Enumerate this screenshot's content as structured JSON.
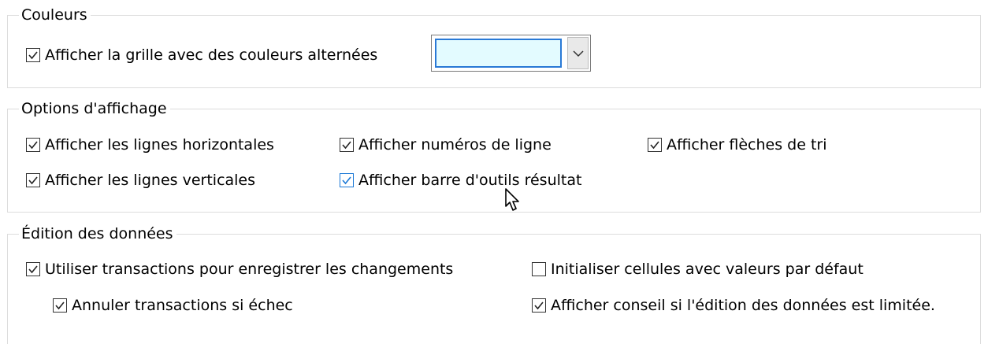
{
  "colors": {
    "legend": "Couleurs",
    "alt_grid": {
      "label": "Afficher la grille avec des couleurs alternées",
      "checked": true
    },
    "color_dropdown": {
      "value": "",
      "swatch_color": "#e3fbff",
      "icon": "chevron-down-icon"
    }
  },
  "display": {
    "legend": "Options d'affichage",
    "items": [
      {
        "label": "Afficher les lignes horizontales",
        "checked": true
      },
      {
        "label": "Afficher numéros de ligne",
        "checked": true
      },
      {
        "label": "Afficher flèches de tri",
        "checked": true
      },
      {
        "label": "Afficher les lignes verticales",
        "checked": true
      },
      {
        "label": "Afficher barre d'outils résultat",
        "checked": true,
        "hover": true
      }
    ]
  },
  "editing": {
    "legend": "Édition des données",
    "items": [
      {
        "label": "Utiliser transactions pour enregistrer les changements",
        "checked": true
      },
      {
        "label": "Initialiser cellules avec valeurs par défaut",
        "checked": false
      },
      {
        "label": "Annuler transactions si échec",
        "checked": true
      },
      {
        "label": "Afficher conseil si l'édition des données est limitée.",
        "checked": true
      }
    ]
  },
  "accent_color": "#1a78d6"
}
